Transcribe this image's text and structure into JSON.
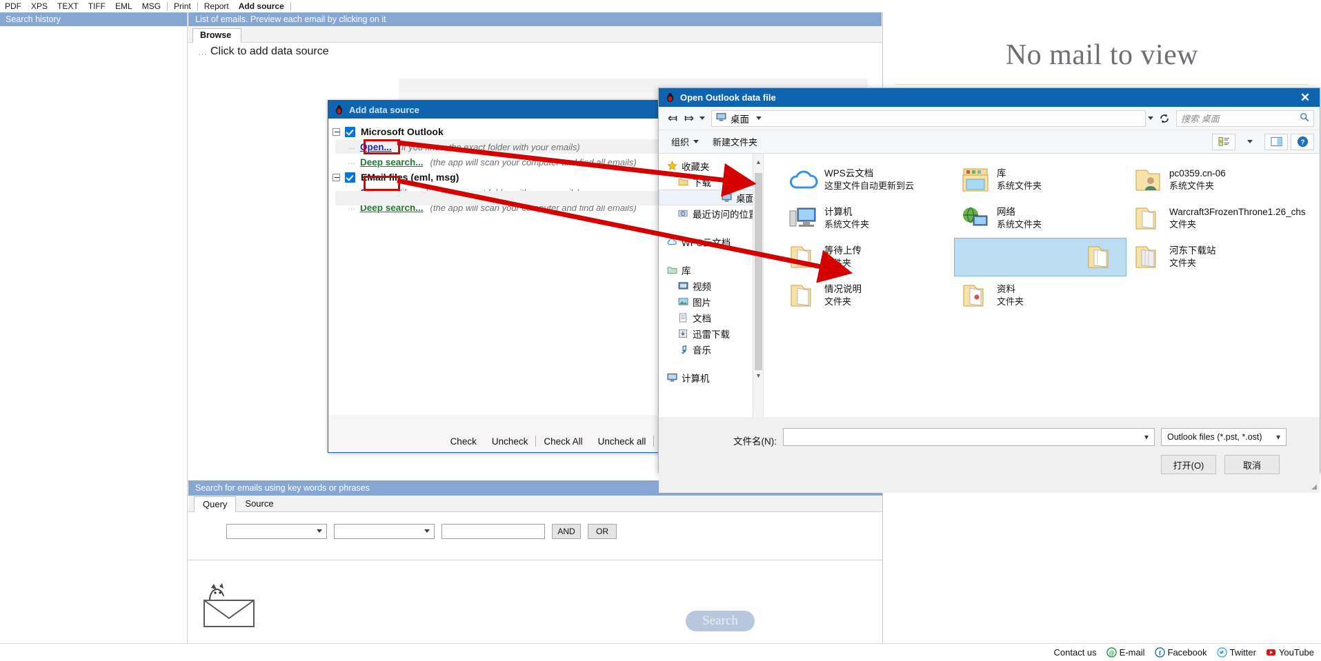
{
  "topmenu": {
    "items": [
      "PDF",
      "XPS",
      "TEXT",
      "TIFF",
      "EML",
      "MSG",
      "Print",
      "Report",
      "Add source"
    ],
    "active": "Add source"
  },
  "left_pane": {
    "header": "Search history"
  },
  "center": {
    "header": "List of emails. Preview each email by clicking on it",
    "browse_tab": "Browse",
    "tree_root": "Click to add data source",
    "dash": "…"
  },
  "right_pane": {
    "no_mail": "No mail to view"
  },
  "add_data_source": {
    "title": "Add data source",
    "nodes": [
      {
        "label": "Microsoft Outlook",
        "open_link": "Open...",
        "open_hint": "(if you know the exact folder with your emails)",
        "deep_link": "Deep search...",
        "deep_hint": "(the app will scan your computer and find all emails)"
      },
      {
        "label": "EMail files (eml, msg)",
        "open_link": "Open...",
        "open_hint": "(if you know the exact folder with your emails)",
        "deep_link": "Deep search...",
        "deep_hint": "(the app will scan your computer and find all emails)"
      }
    ],
    "check_bar": [
      "Check",
      "Uncheck",
      "Check All",
      "Uncheck all"
    ]
  },
  "search_panel": {
    "header": "Search for emails using key words or phrases",
    "tabs": [
      "Query",
      "Source"
    ],
    "active_tab": "Query",
    "field_value": "",
    "operator_value": "",
    "keyword_value": "",
    "and_label": "AND",
    "or_label": "OR",
    "search_button": "Search"
  },
  "footer": {
    "contact": "Contact us",
    "links": [
      {
        "label": "E-mail",
        "icon": "email-icon"
      },
      {
        "label": "Facebook",
        "icon": "facebook-icon"
      },
      {
        "label": "Twitter",
        "icon": "twitter-icon"
      },
      {
        "label": "YouTube",
        "icon": "youtube-icon"
      }
    ]
  },
  "file_dialog": {
    "title": "Open Outlook data file",
    "close": "✕",
    "breadcrumb": "桌面",
    "search_placeholder": "搜索 桌面",
    "toolbar": {
      "organize": "组织",
      "new_folder": "新建文件夹"
    },
    "sidebar": [
      {
        "label": "收藏夹",
        "icon": "star-icon",
        "level": 0,
        "selected": false
      },
      {
        "label": "下载",
        "icon": "folder-icon",
        "level": 1,
        "selected": false
      },
      {
        "label": "桌面",
        "icon": "desktop-icon",
        "level": 1,
        "selected": true
      },
      {
        "label": "最近访问的位置",
        "icon": "recent-icon",
        "level": 1,
        "selected": false
      },
      {
        "label": "WPS云文档",
        "icon": "cloud-icon",
        "level": 0,
        "selected": false
      },
      {
        "label": "库",
        "icon": "library-icon",
        "level": 0,
        "selected": false
      },
      {
        "label": "视频",
        "icon": "video-icon",
        "level": 1,
        "selected": false
      },
      {
        "label": "图片",
        "icon": "picture-icon",
        "level": 1,
        "selected": false
      },
      {
        "label": "文档",
        "icon": "document-icon",
        "level": 1,
        "selected": false
      },
      {
        "label": "迅雷下载",
        "icon": "download-icon",
        "level": 1,
        "selected": false
      },
      {
        "label": "音乐",
        "icon": "music-icon",
        "level": 1,
        "selected": false
      },
      {
        "label": "计算机",
        "icon": "computer-icon",
        "level": 0,
        "selected": false
      }
    ],
    "files": [
      {
        "name": "WPS云文档",
        "type": "这里文件自动更新到云",
        "icon": "cloud-icon",
        "selected": false
      },
      {
        "name": "库",
        "type": "系统文件夹",
        "icon": "library-folder-icon",
        "selected": false
      },
      {
        "name": "pc0359.cn-06",
        "type": "系统文件夹",
        "icon": "user-folder-icon",
        "selected": false
      },
      {
        "name": "计算机",
        "type": "系统文件夹",
        "icon": "computer-icon",
        "selected": false
      },
      {
        "name": "网络",
        "type": "系统文件夹",
        "icon": "network-icon",
        "selected": false
      },
      {
        "name": "Warcraft3FrozenThrone1.26_chs",
        "type": "文件夹",
        "icon": "folder-icon",
        "selected": false
      },
      {
        "name": "等待上传",
        "type": "文件夹",
        "icon": "folder-icon",
        "selected": false
      },
      {
        "name": "",
        "type": "",
        "icon": "folder-icon",
        "selected": true
      },
      {
        "name": "河东下载站",
        "type": "文件夹",
        "icon": "folder-icon",
        "selected": false
      },
      {
        "name": "情况说明",
        "type": "文件夹",
        "icon": "folder-icon",
        "selected": false
      },
      {
        "name": "资料",
        "type": "文件夹",
        "icon": "folder-icon",
        "selected": false
      }
    ],
    "filename_label": "文件名(N):",
    "filename_value": "",
    "filter_value": "Outlook files (*.pst, *.ost)",
    "open_button": "打开(O)",
    "cancel_button": "取消"
  },
  "colors": {
    "titlebar_blue": "#0f64b0",
    "header_blue": "#86a7d4",
    "annotation_red": "#d40000",
    "link_blue": "#1d23c4",
    "link_green": "#1f7a2e",
    "selection_blue": "#bcdcf4"
  }
}
